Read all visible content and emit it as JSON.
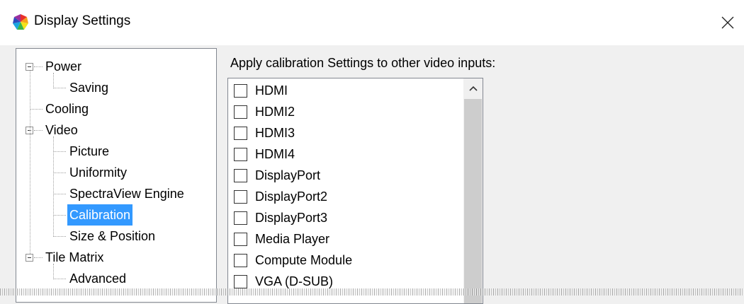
{
  "window": {
    "title": "Display Settings",
    "icon": "color-wheel-icon",
    "close_icon": "close-icon"
  },
  "tree": {
    "items": [
      {
        "label": "Power",
        "level": 0,
        "expanded": true
      },
      {
        "label": "Saving",
        "level": 1
      },
      {
        "label": "Cooling",
        "level": 0
      },
      {
        "label": "Video",
        "level": 0,
        "expanded": true
      },
      {
        "label": "Picture",
        "level": 1
      },
      {
        "label": "Uniformity",
        "level": 1
      },
      {
        "label": "SpectraView Engine",
        "level": 1
      },
      {
        "label": "Calibration",
        "level": 1,
        "selected": true
      },
      {
        "label": "Size & Position",
        "level": 1
      },
      {
        "label": "Tile Matrix",
        "level": 0,
        "expanded": true
      },
      {
        "label": "Advanced",
        "level": 1
      }
    ],
    "selected_color": "#3399ff"
  },
  "calibration": {
    "apply_label": "Apply calibration Settings to other video inputs:",
    "inputs": [
      {
        "label": "HDMI",
        "checked": false
      },
      {
        "label": "HDMI2",
        "checked": false
      },
      {
        "label": "HDMI3",
        "checked": false
      },
      {
        "label": "HDMI4",
        "checked": false
      },
      {
        "label": "DisplayPort",
        "checked": false
      },
      {
        "label": "DisplayPort2",
        "checked": false
      },
      {
        "label": "DisplayPort3",
        "checked": false
      },
      {
        "label": "Media Player",
        "checked": false
      },
      {
        "label": "Compute Module",
        "checked": false
      },
      {
        "label": "VGA (D-SUB)",
        "checked": false
      }
    ]
  }
}
